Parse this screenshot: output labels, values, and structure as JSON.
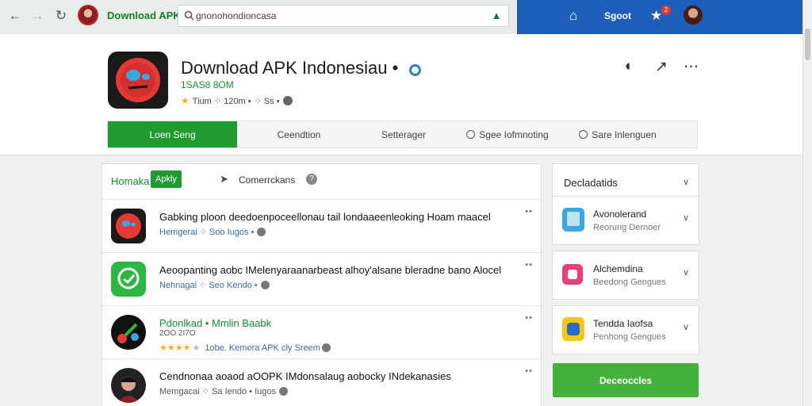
{
  "browser": {
    "site_name": "Download APK",
    "search_value": "gnonohondioncasa"
  },
  "topbar": {
    "account_label": "Sgoot",
    "notification_count": "2"
  },
  "app": {
    "title": "Download APK Indonesiau •",
    "subtitle": "1SAS8 8OM",
    "meta_rating": "Tium ⁘ 120m •",
    "meta_users": "⁘ Ss •"
  },
  "tabs": [
    {
      "label": "Loen Seng"
    },
    {
      "label": "Ceendtion"
    },
    {
      "label": "Setterager"
    },
    {
      "label": "Sgee Iofmnoting"
    },
    {
      "label": "Sare Inlenguen"
    }
  ],
  "list": {
    "header_label": "Homaka",
    "header_chip": "Apkly",
    "header_comments": "Comerrckans",
    "items": [
      {
        "title": "Gabking ploon deedoenpoceellonau tail londaaeenleoking Hoam maacel",
        "meta": "Hemgerai ⁘ Soo Iugos •",
        "icon": "red-bot"
      },
      {
        "title": "Aeoopanting aobc IMelenyaraanarbeast alhoy'alsane bleradne bano Alocel",
        "meta": "Nehnagai ⁘ Seo Kendo •",
        "icon": "green-chat"
      },
      {
        "title": "Pdonlkad",
        "title_suffix": "• Mmlin Baabk",
        "extra": "2OO 2I7O",
        "meta": "1obe. Kemera APK cly Sreem",
        "icon": "dark-orbit",
        "stars": 3.5
      },
      {
        "title": "Cendnonaa aoaod aOOPK IMdonsalaug aobocky INdekanasies",
        "meta": "Memgacai ⁘ Sa Iendo • Iugos",
        "icon": "person"
      }
    ]
  },
  "sidebar": {
    "title": "Decladatids",
    "cards": [
      {
        "title": "Avonolerand",
        "sub": "Reorung Dernoer",
        "icon": "phone"
      },
      {
        "title": "Alchemdina",
        "sub": "Beedong Gengues",
        "icon": "pink-app"
      },
      {
        "title": "Tendda Iaofsa",
        "sub": "Penhong Gengues",
        "icon": "yellow-app"
      }
    ],
    "button_label": "Deceoccles"
  },
  "colors": {
    "brand_green": "#1f9b2f",
    "top_blue": "#1d5fb8",
    "button_green": "#46b13a"
  }
}
